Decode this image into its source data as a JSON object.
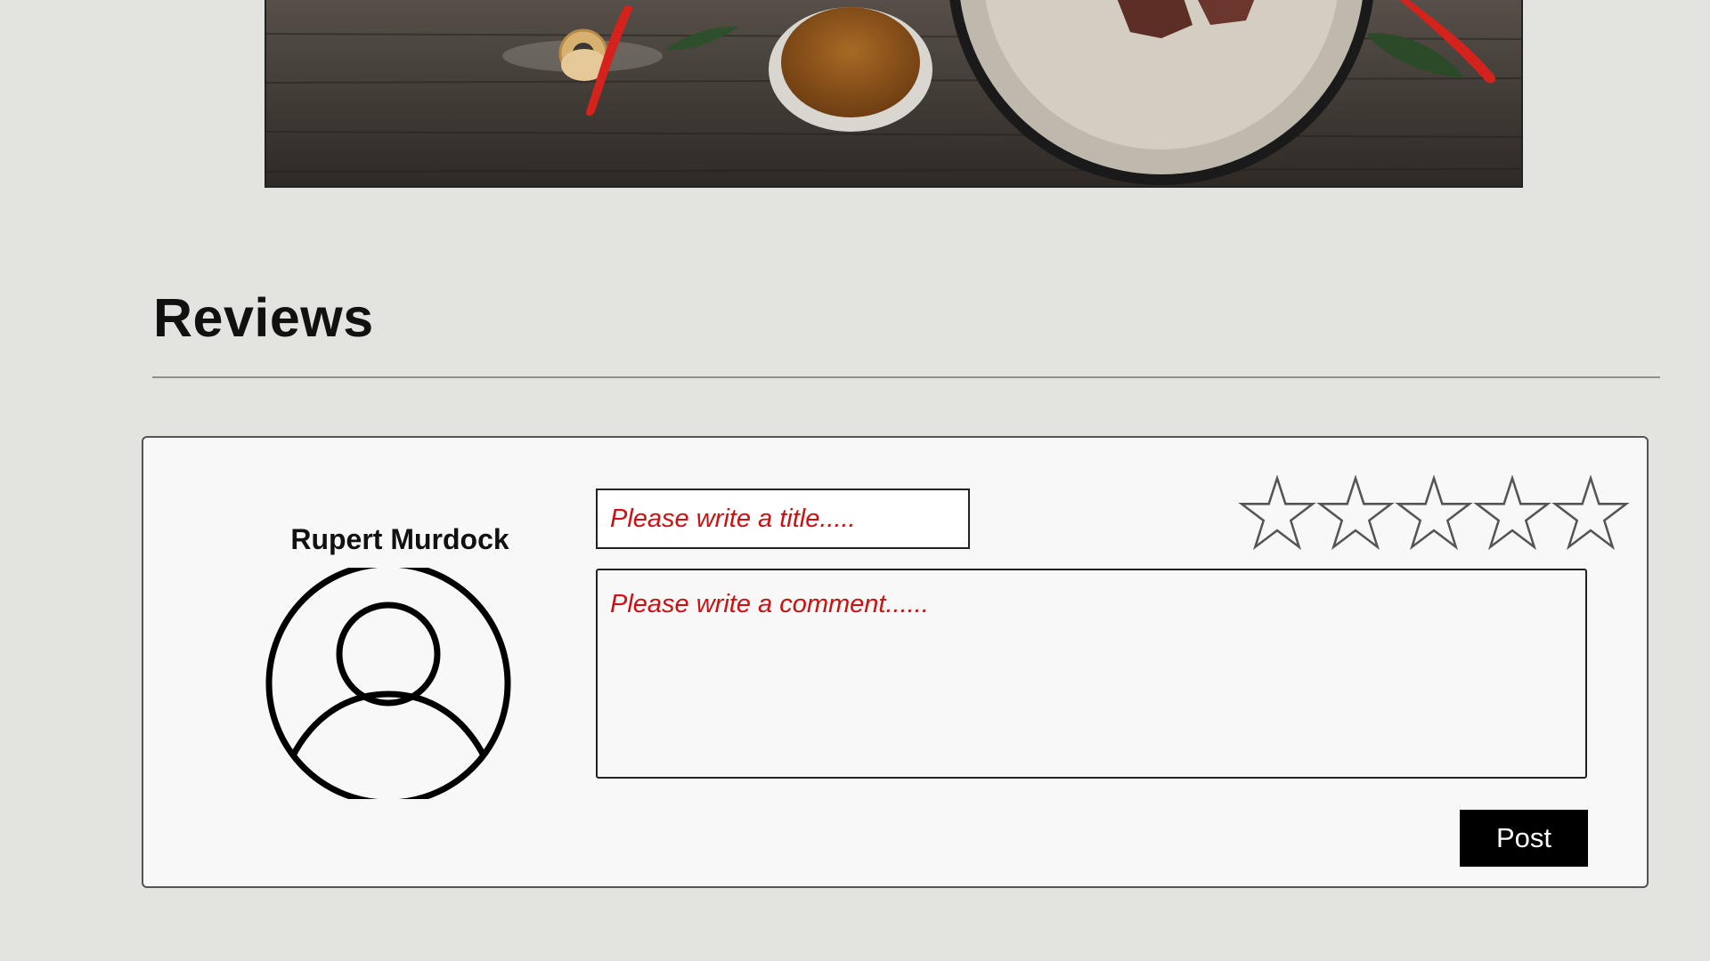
{
  "hero": {
    "image_name": "food-photo"
  },
  "reviews": {
    "heading": "Reviews"
  },
  "review_form": {
    "user_name": "Rupert Murdock",
    "avatar_icon": "user-avatar-icon",
    "title_placeholder": "Please write a title.....",
    "comment_placeholder": "Please write a comment......",
    "rating": 0,
    "rating_max": 5,
    "star_icon": "star-outline-icon",
    "post_label": "Post"
  },
  "colors": {
    "background": "#e3e3df",
    "card": "#f8f8f8",
    "placeholder_text": "#cc1111",
    "button": "#000000",
    "button_text": "#ffffff"
  }
}
